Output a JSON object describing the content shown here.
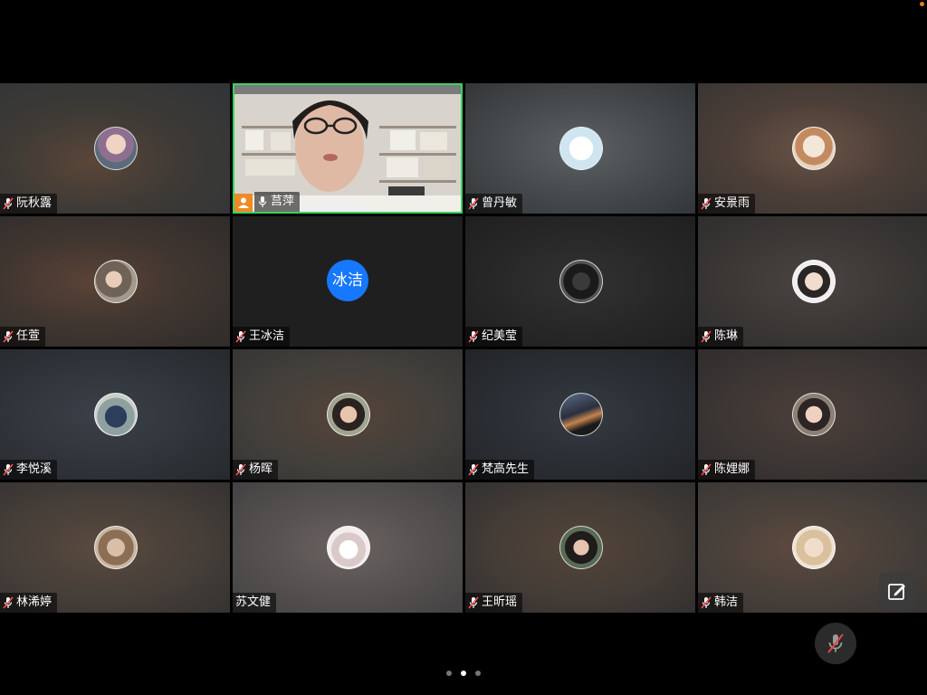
{
  "colors": {
    "active_border": "#3bd260",
    "host_badge": "#f08a24",
    "text_avatar_bg": "#1677ff",
    "status_dot": "#e0811c"
  },
  "participants": [
    {
      "name": "阮秋露",
      "muted": true,
      "avatar": "photo"
    },
    {
      "name": "莒萍",
      "muted": false,
      "host": true,
      "active_speaker": true,
      "avatar": "video"
    },
    {
      "name": "曾丹敏",
      "muted": true,
      "avatar": "photo"
    },
    {
      "name": "安景雨",
      "muted": true,
      "avatar": "photo"
    },
    {
      "name": "任萱",
      "muted": true,
      "avatar": "photo"
    },
    {
      "name": "王冰洁",
      "muted": true,
      "avatar": "text",
      "avatar_text": "冰洁"
    },
    {
      "name": "纪美莹",
      "muted": true,
      "avatar": "photo"
    },
    {
      "name": "陈琳",
      "muted": true,
      "avatar": "photo"
    },
    {
      "name": "李悦溪",
      "muted": true,
      "avatar": "photo"
    },
    {
      "name": "杨晖",
      "muted": true,
      "avatar": "photo"
    },
    {
      "name": "梵高先生",
      "muted": true,
      "avatar": "photo"
    },
    {
      "name": "陈娌娜",
      "muted": true,
      "avatar": "photo"
    },
    {
      "name": "林浠婷",
      "muted": true,
      "avatar": "photo"
    },
    {
      "name": "苏文健",
      "muted": false,
      "avatar": "photo"
    },
    {
      "name": "王昕瑶",
      "muted": true,
      "avatar": "photo"
    },
    {
      "name": "韩洁",
      "muted": true,
      "avatar": "photo"
    }
  ],
  "pagination": {
    "total_pages": 3,
    "current_page": 2
  },
  "controls": {
    "side_button_icon": "edit-layout-icon",
    "mute_button_icon": "mic-muted-icon"
  }
}
